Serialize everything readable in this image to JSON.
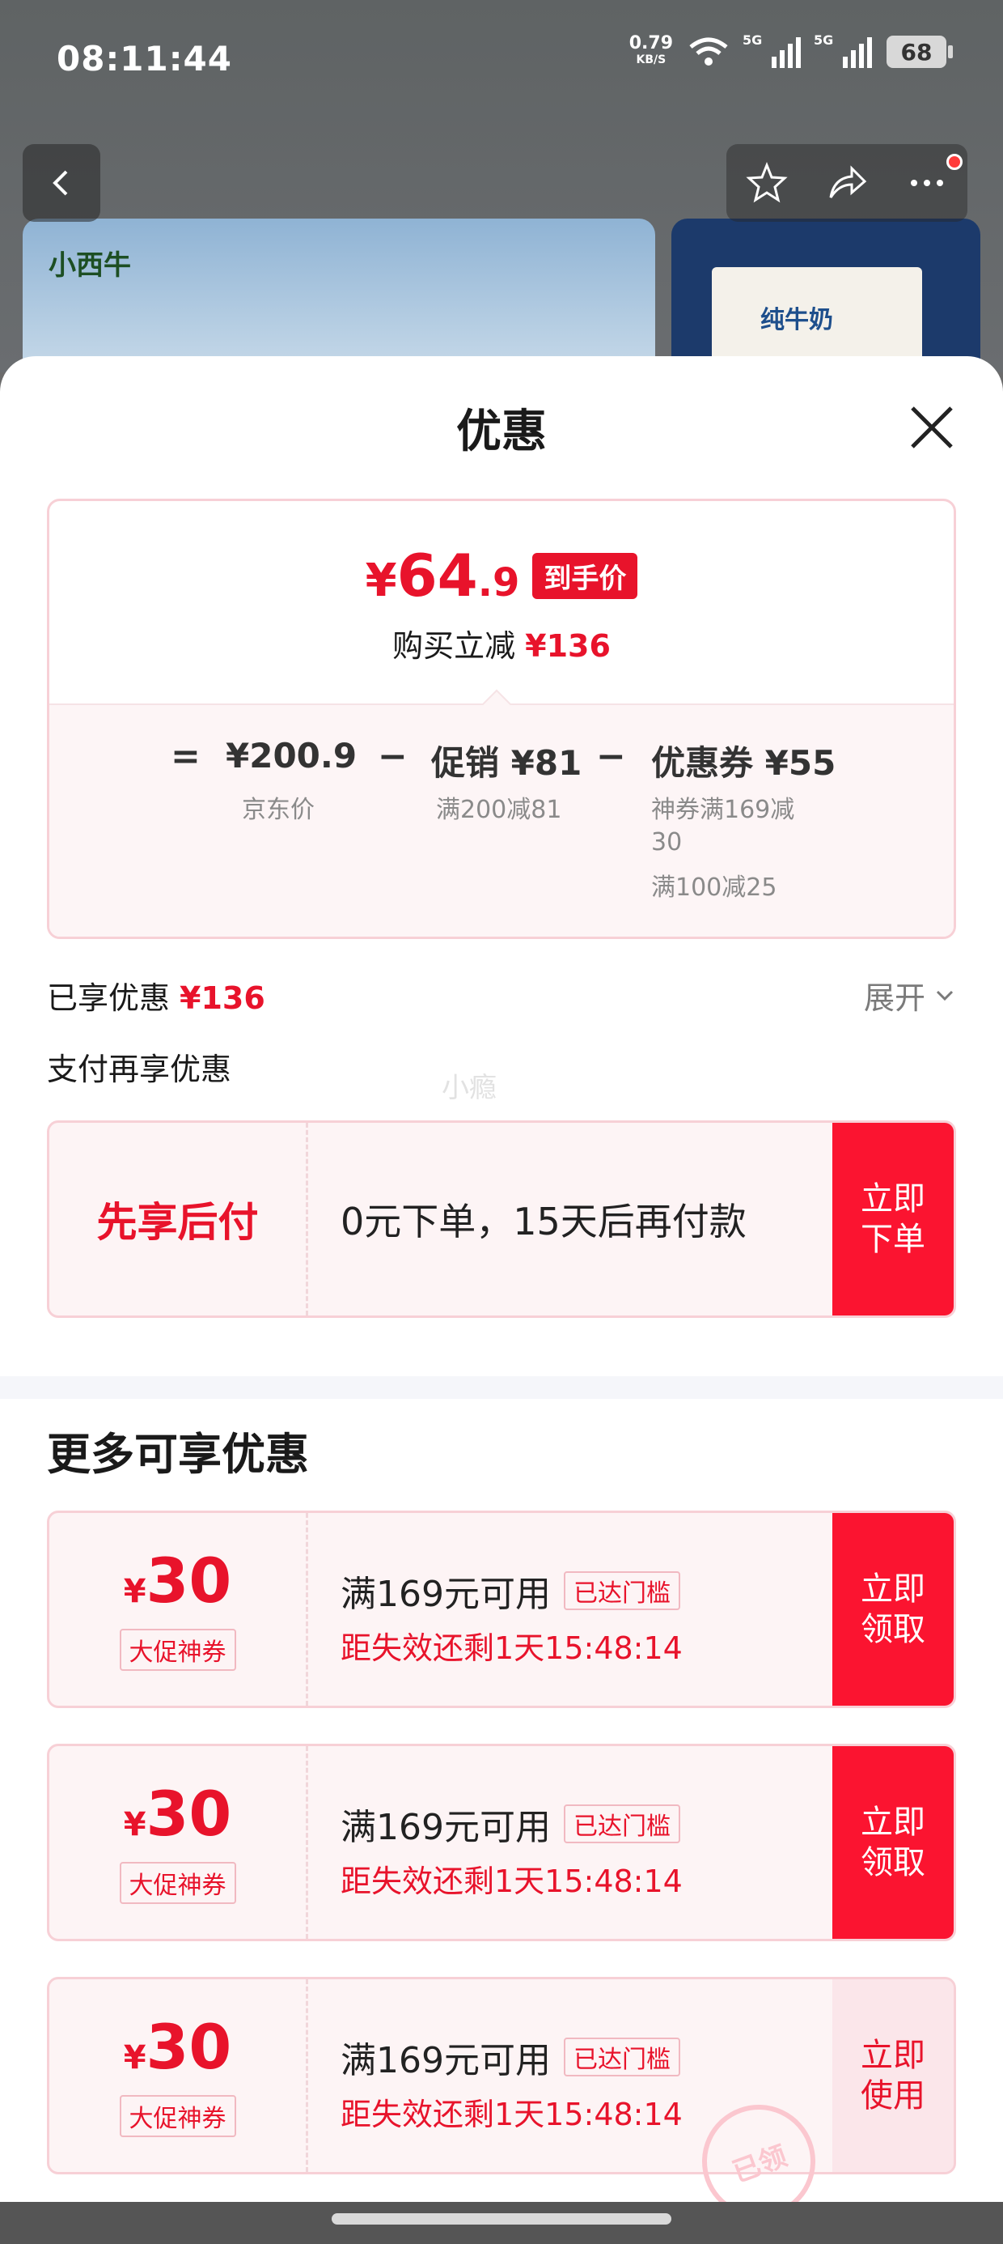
{
  "status_bar": {
    "time": "08:11:44",
    "speed_value": "0.79",
    "speed_unit": "KB/S",
    "network_1": "5G",
    "network_2": "5G",
    "battery": "68"
  },
  "product_bg": {
    "brand_text": "小西牛",
    "box_text": "纯牛奶"
  },
  "sheet": {
    "title": "优惠",
    "summary": {
      "yen": "¥",
      "price_int": "64",
      "price_dec": ".9",
      "price_tag": "到手价",
      "save_label": "购买立减",
      "save_amount": "¥136",
      "equals": "=",
      "minus_1": "−",
      "minus_2": "−",
      "jd_price": "¥200.9",
      "jd_price_label": "京东价",
      "promo": "促销 ¥81",
      "promo_detail": "满200减81",
      "coupon": "优惠券 ¥55",
      "coupon_detail_1a": "神券满169减",
      "coupon_detail_1b": "30",
      "coupon_detail_2": "满100减25"
    },
    "enjoyed_label": "已享优惠",
    "enjoyed_amount": "¥136",
    "expand_label": "展开",
    "pay_title": "支付再享优惠",
    "watermark": "小瘾",
    "bnpl": {
      "label": "先享后付",
      "text": "0元下单，15天后再付款",
      "cta_1": "立即",
      "cta_2": "下单"
    },
    "more_title": "更多可享优惠",
    "coupons": [
      {
        "yen": "¥",
        "amount": "30",
        "type": "大促神券",
        "condition": "满169元可用",
        "reached": "已达门槛",
        "expire": "距失效还剩1天15:48:14",
        "cta_1": "立即",
        "cta_2": "领取"
      },
      {
        "yen": "¥",
        "amount": "30",
        "type": "大促神券",
        "condition": "满169元可用",
        "reached": "已达门槛",
        "expire": "距失效还剩1天15:48:14",
        "cta_1": "立即",
        "cta_2": "领取"
      },
      {
        "yen": "¥",
        "amount": "30",
        "type": "大促神券",
        "condition": "满169元可用",
        "reached": "已达门槛",
        "expire": "距失效还剩1天15:48:14",
        "cta_1": "立即",
        "cta_2": "使用"
      }
    ],
    "stamp": "已领"
  },
  "icons": [
    "back-icon",
    "star-icon",
    "share-icon",
    "more-icon",
    "close-icon",
    "chevron-down-icon",
    "wifi-icon"
  ],
  "colors": {
    "accent": "#e8132b",
    "cta": "#fb1430"
  }
}
